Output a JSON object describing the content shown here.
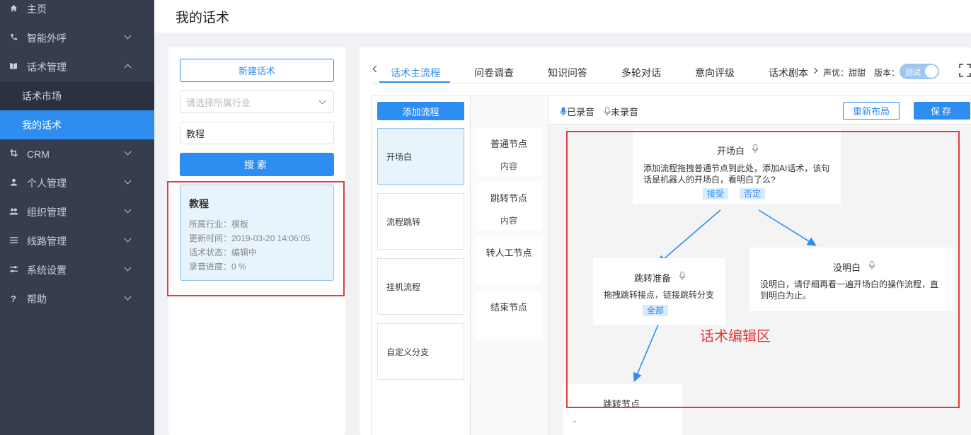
{
  "sidebar": {
    "items": [
      {
        "label": "主页",
        "icon": "home-icon"
      },
      {
        "label": "智能外呼",
        "icon": "phone-icon"
      },
      {
        "label": "话术管理",
        "icon": "book-icon"
      },
      {
        "label": "CRM",
        "icon": "crop-icon"
      },
      {
        "label": "个人管理",
        "icon": "user-icon"
      },
      {
        "label": "组织管理",
        "icon": "users-icon"
      },
      {
        "label": "线路管理",
        "icon": "route-icon"
      },
      {
        "label": "系统设置",
        "icon": "sliders-icon"
      },
      {
        "label": "帮助",
        "icon": "help-icon"
      }
    ],
    "sub_items": [
      "话术市场",
      "我的话术"
    ],
    "active_color": "#2e8df0"
  },
  "header": {
    "title": "我的话术"
  },
  "left_panel": {
    "new_button": "新建话术",
    "industry_placeholder": "请选择所属行业",
    "search_value": "教程",
    "search_button": "搜索",
    "card": {
      "title": "教程",
      "industry": "所属行业：模板",
      "updated": "更新时间：2019-03-20 14:06:05",
      "status": "话术状态：编辑中",
      "progress": "录音进度：0 %"
    }
  },
  "main": {
    "tabs": [
      "话术主流程",
      "问卷调查",
      "知识问答",
      "多轮对话",
      "意向评级",
      "话术剧本"
    ],
    "voice": "声优：甜甜",
    "version": "版本：",
    "toggle_label": "测试",
    "add_flow_button": "添加流程",
    "flows": [
      "开场白",
      "流程跳转",
      "挂机流程",
      "自定义分支"
    ],
    "node_templates": [
      {
        "title": "普通节点",
        "content": "内容"
      },
      {
        "title": "跳转节点",
        "content": "内容"
      },
      {
        "title": "转人工节点",
        "content": ""
      },
      {
        "title": "结束节点",
        "content": ""
      }
    ],
    "legend_recorded": "已录音",
    "legend_unrecorded": "未录音",
    "relayout_button": "重新布局",
    "save_button": "保存"
  },
  "canvas": {
    "opening": {
      "title": "开场白",
      "body": "添加流程拖拽普通节点到此处，添加AI话术，该句话是机器人的开场白，看明白了么?",
      "chips": [
        "接受",
        "否定"
      ]
    },
    "jump_prepare": {
      "title": "跳转准备",
      "body": "拖拽跳转接点，链接跳转分支",
      "chips": [
        "全部"
      ]
    },
    "not_understood": {
      "title": "没明白",
      "body": "没明白，请仔细再看一遍开场白的操作流程，直到明白为止。"
    },
    "jump_node": {
      "title": "跳转节点",
      "body": "-"
    },
    "annotation": "话术编辑区"
  },
  "colors": {
    "accent": "#2e8df0",
    "annotation": "#e83a3a",
    "sidebar_bg": "#363d4e"
  }
}
